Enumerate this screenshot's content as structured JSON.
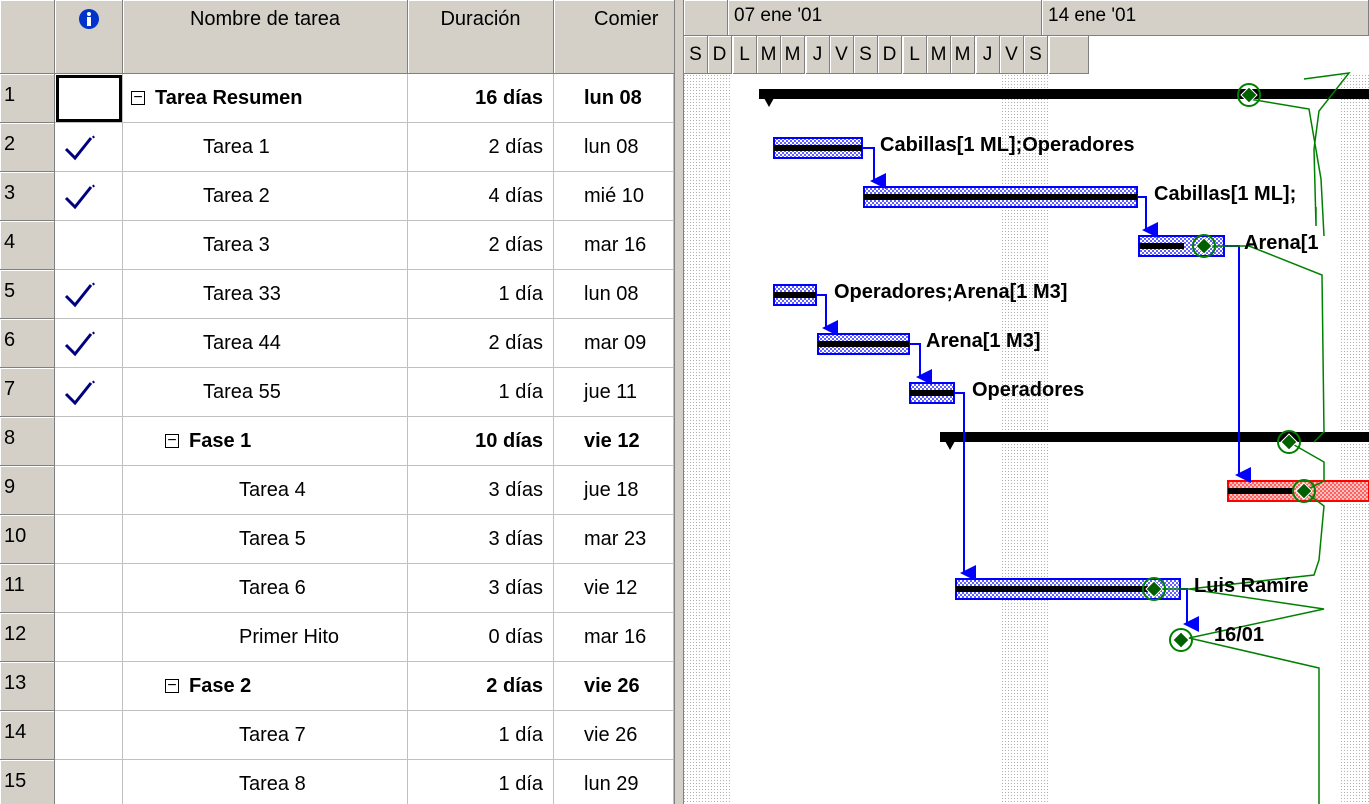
{
  "columns": {
    "indicators_icon": "info-icon",
    "name": "Nombre de tarea",
    "duration": "Duración",
    "start": "Comier"
  },
  "rows": [
    {
      "id": "1",
      "name": "Tarea Resumen",
      "duration": "16 días",
      "start": "lun 08",
      "level": 0,
      "summary": true,
      "done": false,
      "selected": true
    },
    {
      "id": "2",
      "name": "Tarea 1",
      "duration": "2 días",
      "start": "lun 08",
      "level": 1,
      "summary": false,
      "done": true
    },
    {
      "id": "3",
      "name": "Tarea 2",
      "duration": "4 días",
      "start": "mié 10",
      "level": 1,
      "summary": false,
      "done": true
    },
    {
      "id": "4",
      "name": "Tarea 3",
      "duration": "2 días",
      "start": "mar 16",
      "level": 1,
      "summary": false,
      "done": false
    },
    {
      "id": "5",
      "name": "Tarea 33",
      "duration": "1 día",
      "start": "lun 08",
      "level": 1,
      "summary": false,
      "done": true
    },
    {
      "id": "6",
      "name": "Tarea 44",
      "duration": "2 días",
      "start": "mar 09",
      "level": 1,
      "summary": false,
      "done": true
    },
    {
      "id": "7",
      "name": "Tarea 55",
      "duration": "1 día",
      "start": "jue 11",
      "level": 1,
      "summary": false,
      "done": true
    },
    {
      "id": "8",
      "name": "Fase 1",
      "duration": "10 días",
      "start": "vie 12",
      "level": 1,
      "summary": true,
      "done": false
    },
    {
      "id": "9",
      "name": "Tarea 4",
      "duration": "3 días",
      "start": "jue 18",
      "level": 2,
      "summary": false,
      "done": false
    },
    {
      "id": "10",
      "name": "Tarea 5",
      "duration": "3 días",
      "start": "mar 23",
      "level": 2,
      "summary": false,
      "done": false
    },
    {
      "id": "11",
      "name": "Tarea 6",
      "duration": "3 días",
      "start": "vie 12",
      "level": 2,
      "summary": false,
      "done": false
    },
    {
      "id": "12",
      "name": "Primer Hito",
      "duration": "0 días",
      "start": "mar 16",
      "level": 2,
      "summary": false,
      "done": false
    },
    {
      "id": "13",
      "name": "Fase 2",
      "duration": "2 días",
      "start": "vie 26",
      "level": 1,
      "summary": true,
      "done": false
    },
    {
      "id": "14",
      "name": "Tarea 7",
      "duration": "1 día",
      "start": "vie 26",
      "level": 2,
      "summary": false,
      "done": false
    },
    {
      "id": "15",
      "name": "Tarea 8",
      "duration": "1 día",
      "start": "lun 29",
      "level": 2,
      "summary": false,
      "done": false
    }
  ],
  "timescale": {
    "weeks": [
      "07 ene '01",
      "14 ene '01"
    ],
    "days": [
      "S",
      "D",
      "L",
      "M",
      "M",
      "J",
      "V",
      "S",
      "D",
      "L",
      "M",
      "M",
      "J",
      "V",
      "S"
    ]
  },
  "gantt_labels": {
    "row2": "Cabillas[1 ML];Operadores",
    "row3": "Cabillas[1 ML];",
    "row4": "Arena[1",
    "row5": "Operadores;Arena[1 M3]",
    "row6": "Arena[1 M3]",
    "row7": "Operadores",
    "row11": "Luis Ramíre",
    "row12": "16/01"
  },
  "colors": {
    "chrome": "#d4d0c8",
    "bar_blue": "#0000ff",
    "bar_red": "#ff0000",
    "progress": "#000000",
    "link": "#0000ff",
    "slack": "#008000"
  }
}
